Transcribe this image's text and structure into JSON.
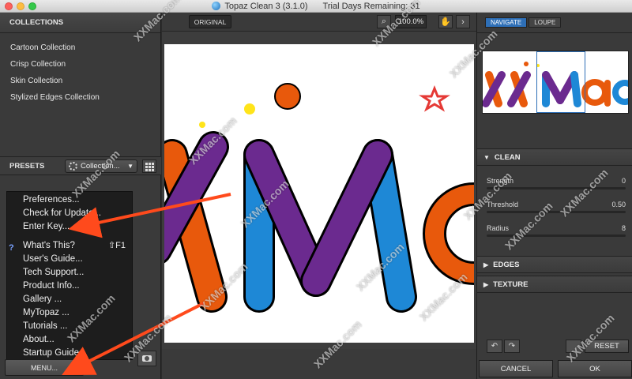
{
  "window": {
    "app_title": "Topaz Clean 3 (3.1.0)",
    "trial_text": "Trial Days Remaining: 31"
  },
  "left_panel": {
    "collections_header": "COLLECTIONS",
    "collections": [
      "Cartoon Collection",
      "Crisp Collection",
      "Skin Collection",
      "Stylized Edges Collection"
    ],
    "presets_label": "PRESETS",
    "collection_dropdown": "Collection...",
    "menu_button": "MENU..."
  },
  "menu": {
    "group1": [
      "Preferences...",
      "Check for Update...",
      "Enter Key..."
    ],
    "whats_this": "What's This?",
    "whats_this_shortcut": "⇧F1",
    "group2": [
      "User's Guide...",
      "Tech Support...",
      "Product Info...",
      "Gallery ...",
      "MyTopaz ...",
      "Tutorials ...",
      "About...",
      "Startup Guide..."
    ]
  },
  "toolbar": {
    "original_label": "ORIGINAL",
    "zoom": "100.0%"
  },
  "canvas": {
    "logo_text": "XMa"
  },
  "right_panel": {
    "tabs": [
      {
        "label": "NAVIGATE",
        "active": true
      },
      {
        "label": "LOUPE",
        "active": false
      }
    ],
    "sections": {
      "clean": "CLEAN",
      "edges": "EDGES",
      "texture": "TEXTURE"
    },
    "sliders": [
      {
        "label": "Strength",
        "value": "0"
      },
      {
        "label": "Threshold",
        "value": "0.50"
      },
      {
        "label": "Radius",
        "value": "8"
      }
    ],
    "reset_label": "RESET",
    "cancel_label": "CANCEL",
    "ok_label": "OK"
  },
  "watermark": "XXMac.com",
  "colors": {
    "purple": "#6b2a8f",
    "blue": "#1e88d6",
    "orange": "#e8590c",
    "red": "#e53935",
    "yellow": "#ffe41a",
    "arrow": "#ff4a1c",
    "accent": "#2e6fb7"
  }
}
